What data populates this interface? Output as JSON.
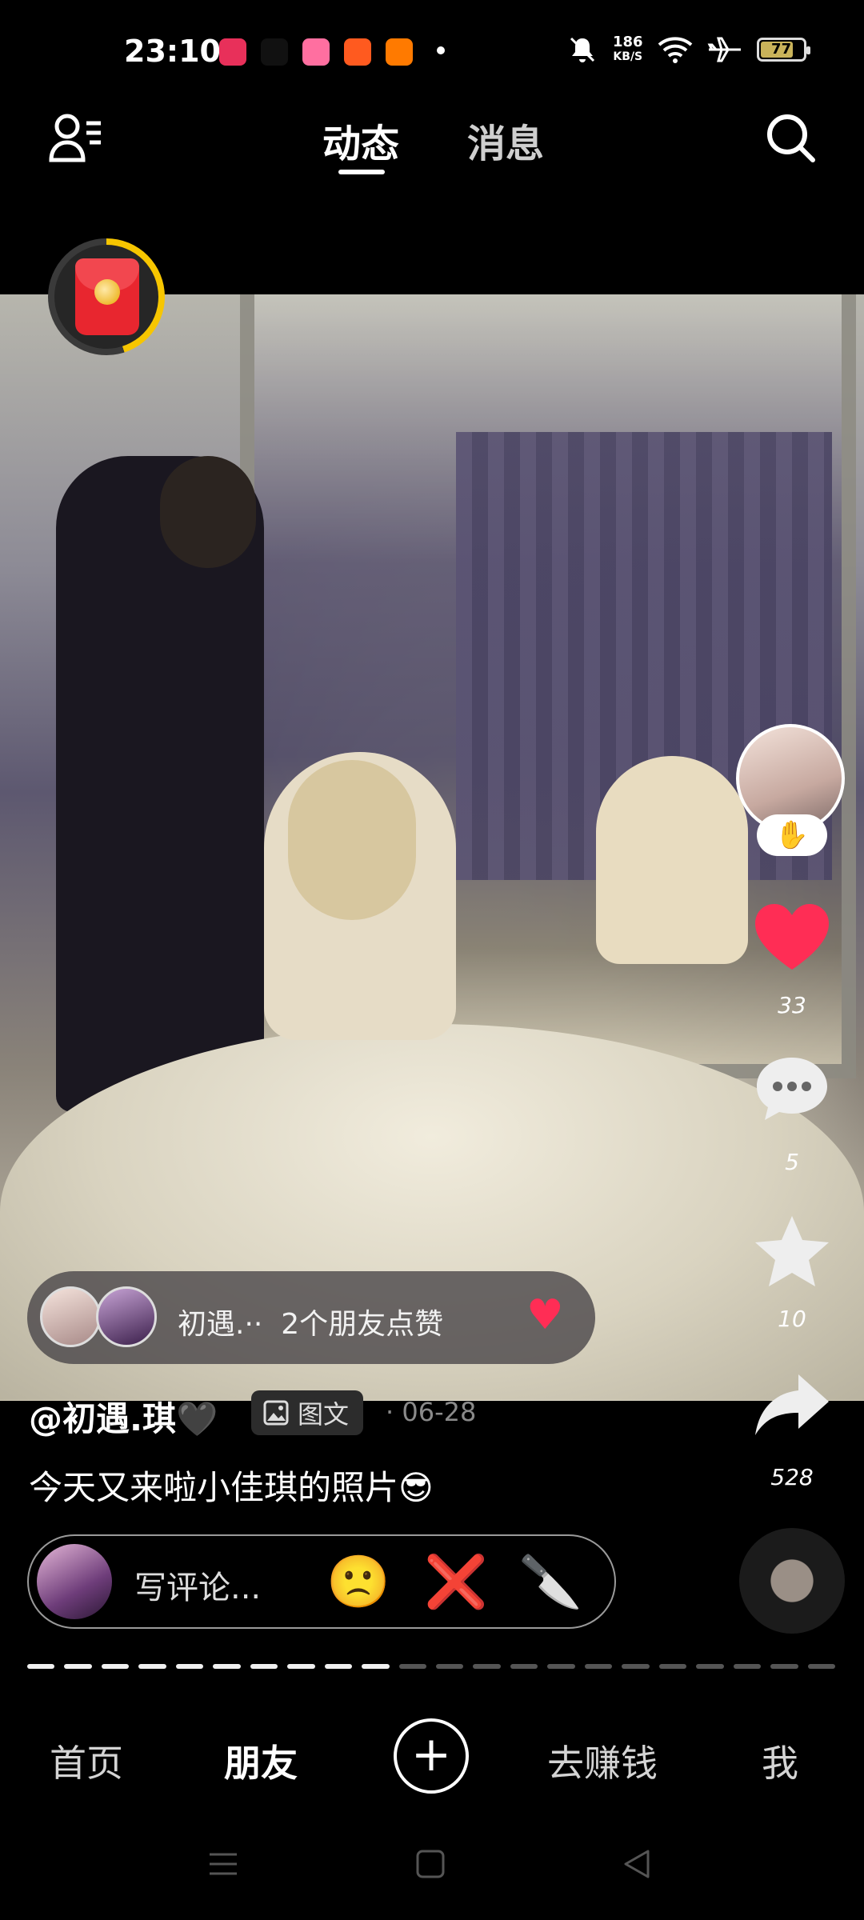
{
  "status_bar": {
    "time": "23:10",
    "app_icons": [
      {
        "name": "music-app-icon",
        "color": "#e8305a"
      },
      {
        "name": "tiktok-icon",
        "color": "#111111"
      },
      {
        "name": "bilibili-icon",
        "color": "#ff6fa0"
      },
      {
        "name": "video-app-icon",
        "color": "#ff5a1f"
      },
      {
        "name": "shop-app-icon",
        "color": "#ff7a00"
      }
    ],
    "speed_value": "186",
    "speed_unit": "KB/S",
    "battery": "77"
  },
  "top_nav": {
    "tabs": [
      {
        "label": "动态",
        "active": true
      },
      {
        "label": "消息",
        "active": false
      }
    ]
  },
  "actions": {
    "likes": "33",
    "comments": "5",
    "favorites": "10",
    "shares": "528"
  },
  "liked_bar": {
    "text": "初遇.··  2个朋友点赞"
  },
  "post": {
    "author": "@初遇.琪🖤",
    "type_label": "图文",
    "date": "· 06-28",
    "caption": "今天又来啦小佳琪的照片😎"
  },
  "comment": {
    "placeholder": "写评论...",
    "emojis": [
      "🙁",
      "❌",
      "🔪"
    ]
  },
  "progress": {
    "total": 22,
    "done": 10
  },
  "bottom_nav": {
    "items": [
      {
        "label": "首页",
        "active": false
      },
      {
        "label": "朋友",
        "active": true
      },
      {
        "label": "去赚钱",
        "active": false
      },
      {
        "label": "我",
        "active": false
      }
    ]
  },
  "colors": {
    "like_red": "#ff2d55",
    "ring_yellow": "#f7c600",
    "red_packet": "#e8262f"
  }
}
